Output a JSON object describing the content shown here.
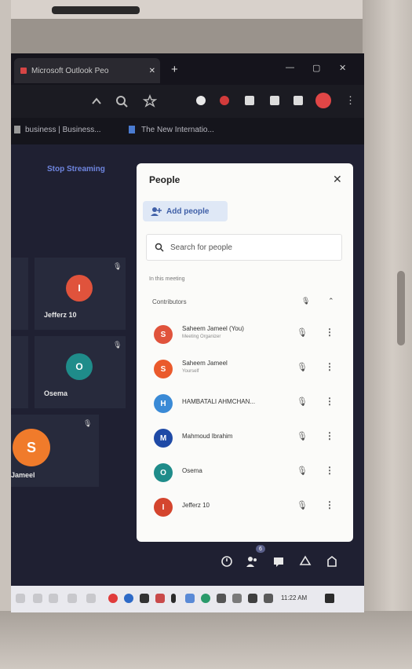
{
  "browser": {
    "tab_title": "Microsoft Outlook Peo",
    "tab_close": "✕",
    "new_tab": "+",
    "win_min": "—",
    "win_max": "▢",
    "win_close": "✕",
    "bookmarks": [
      "business | Business...",
      "The New Internatio..."
    ]
  },
  "meeting": {
    "stop_streaming": "Stop Streaming",
    "tiles": [
      {
        "initial": "I",
        "name": "Jefferz 10",
        "color": "#e0533c"
      },
      {
        "initial": "O",
        "name": "Osema",
        "color": "#1f8c8a"
      },
      {
        "initial": "S",
        "name": "Jameel",
        "color": "#f07b2b"
      }
    ],
    "participant_count": "6"
  },
  "people_panel": {
    "title": "People",
    "close": "✕",
    "add_people": "Add people",
    "search_placeholder": "Search for people",
    "section_label": "In this meeting",
    "contributors_label": "Contributors",
    "people": [
      {
        "initial": "S",
        "name": "Saheem Jameel (You)",
        "sub": "Meeting Organizer",
        "color": "#e0533c"
      },
      {
        "initial": "S",
        "name": "Saheem Jameel",
        "sub": "Yourself",
        "color": "#ea5a2c"
      },
      {
        "initial": "H",
        "name": "HAMBATALI AHMCHAN...",
        "sub": "",
        "color": "#3a8ad6"
      },
      {
        "initial": "M",
        "name": "Mahmoud Ibrahim",
        "sub": "",
        "color": "#1f4aa6"
      },
      {
        "initial": "O",
        "name": "Osema",
        "sub": "",
        "color": "#1f8c8a"
      },
      {
        "initial": "I",
        "name": "Jefferz 10",
        "sub": "",
        "color": "#d4452e"
      }
    ]
  },
  "taskbar": {
    "time": "11:22 AM"
  },
  "icons": {
    "mic_off": "🎙",
    "more": "⋮",
    "search": "🔍",
    "add_person": "👥"
  }
}
